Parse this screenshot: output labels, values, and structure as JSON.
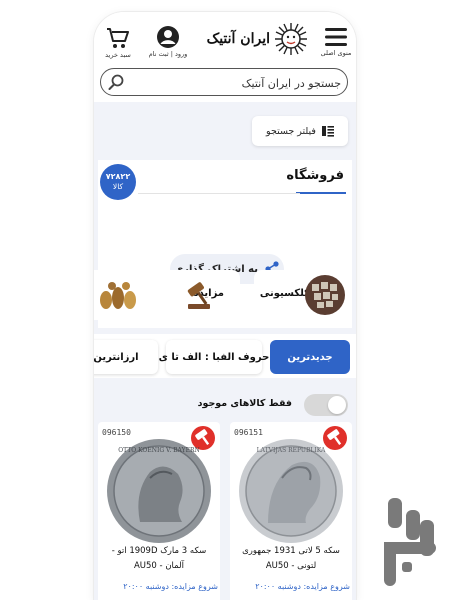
{
  "header": {
    "cart_label": "سبد خرید",
    "account_label": "ورود | ثبت نام",
    "logo_text": "ایران آنتیک",
    "menu_label": "منوی اصلی"
  },
  "search": {
    "placeholder": "جستجو در ایران آنتیک"
  },
  "filter": {
    "label": "فیلتر جستجو"
  },
  "shop": {
    "title": "فروشگاه",
    "count": "۷۲۸۲۲",
    "count_unit": "کالا",
    "share_label": "به اشتراک گذاری"
  },
  "categories": [
    {
      "label": "کلکسیونی",
      "icon": "stamps-collection-image"
    },
    {
      "label": "مزایده",
      "icon": "auction-gavel-image"
    },
    {
      "label": "",
      "icon": "antique-brass-items-image"
    }
  ],
  "sort_tabs": [
    {
      "label": "جدیدترین",
      "active": true
    },
    {
      "label": "حروف الفبا : الف تا ی",
      "active": false
    },
    {
      "label": "ارزانترین",
      "active": false
    }
  ],
  "stock_filter": {
    "label": "فقط کالاهای موجود",
    "on": false
  },
  "products": [
    {
      "id": "096151",
      "title": "سکه 5 لاتی 1931 جمهوری لتونی - AU50",
      "auction_start": "شروع مزایده: دوشنبه ۲۰:۰۰"
    },
    {
      "id": "096150",
      "title": "سکه 3 مارک 1909D اتو - آلمان - AU50",
      "auction_start": "شروع مزایده: دوشنبه ۲۰:۰۰"
    }
  ],
  "colors": {
    "accent": "#2f64c7",
    "bid_icon": "#e0302a",
    "background": "#f1f3f9"
  }
}
